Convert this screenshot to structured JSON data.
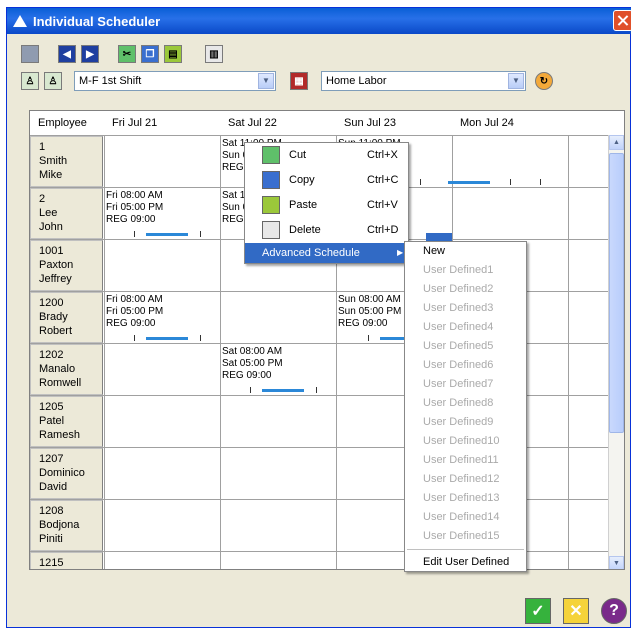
{
  "window": {
    "title": "Individual Scheduler"
  },
  "toolbar": {
    "shift_value": "M-F 1st Shift",
    "labor_value": "Home Labor"
  },
  "grid": {
    "col_employee": "Employee",
    "days": [
      "Fri Jul 21",
      "Sat Jul 22",
      "Sun Jul 23",
      "Mon Jul 24"
    ],
    "employees": [
      {
        "id": "1",
        "last": "Smith",
        "first": "Mike"
      },
      {
        "id": "2",
        "last": "Lee",
        "first": "John"
      },
      {
        "id": "1001",
        "last": "Paxton",
        "first": "Jeffrey"
      },
      {
        "id": "1200",
        "last": "Brady",
        "first": "Robert"
      },
      {
        "id": "1202",
        "last": "Manalo",
        "first": "Romwell"
      },
      {
        "id": "1205",
        "last": "Patel",
        "first": "Ramesh"
      },
      {
        "id": "1207",
        "last": "Dominico",
        "first": "David"
      },
      {
        "id": "1208",
        "last": "Bodjona",
        "first": "Piniti"
      },
      {
        "id": "1215",
        "last": "",
        "first": ""
      }
    ],
    "shifts": {
      "smith_sat": {
        "l1": "Sat 11:00 PM",
        "l2": "Sun 0",
        "l3": "REG 0"
      },
      "smith_sun": {
        "l1": "Sun 11:00 PM"
      },
      "lee_fri": {
        "l1": "Fri 08:00 AM",
        "l2": "Fri 05:00 PM",
        "l3": "REG 09:00"
      },
      "lee_sat": {
        "l1": "Sat 1",
        "l2": "Sun 0",
        "l3": "REG 0"
      },
      "brady_fri": {
        "l1": "Fri 08:00 AM",
        "l2": "Fri 05:00 PM",
        "l3": "REG 09:00"
      },
      "brady_sun": {
        "l1": "Sun 08:00 AM",
        "l2": "Sun 05:00 PM",
        "l3": "REG 09:00"
      },
      "manalo_sat": {
        "l1": "Sat 08:00 AM",
        "l2": "Sat 05:00 PM",
        "l3": "REG 09:00"
      }
    }
  },
  "context_menu": {
    "cut": "Cut",
    "cut_sc": "Ctrl+X",
    "copy": "Copy",
    "copy_sc": "Ctrl+C",
    "paste": "Paste",
    "paste_sc": "Ctrl+V",
    "delete": "Delete",
    "delete_sc": "Ctrl+D",
    "advanced": "Advanced Schedule"
  },
  "submenu": {
    "new": "New",
    "items": [
      "User Defined1",
      "User Defined2",
      "User Defined3",
      "User Defined4",
      "User Defined5",
      "User Defined6",
      "User Defined7",
      "User Defined8",
      "User Defined9",
      "User Defined10",
      "User Defined11",
      "User Defined12",
      "User Defined13",
      "User Defined14",
      "User Defined15"
    ],
    "edit": "Edit User Defined"
  },
  "colors": {
    "accent": "#316ac5",
    "title": "#0a5fd6",
    "bar": "#2b88d8"
  }
}
